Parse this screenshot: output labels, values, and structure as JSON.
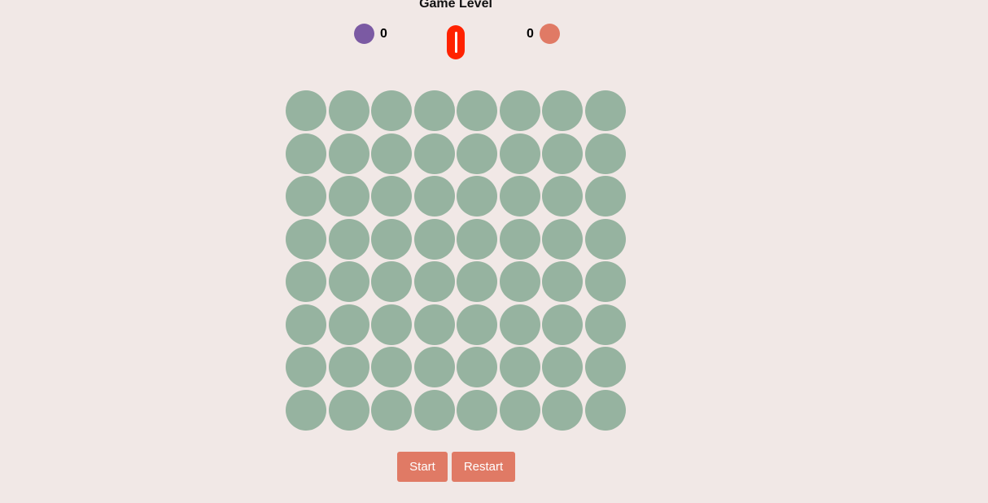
{
  "header": {
    "title": "Game Level"
  },
  "players": [
    {
      "score": "0",
      "color": "#7b5aa3",
      "icon": "purple-token-icon"
    },
    {
      "score": "0",
      "color": "#e07a65",
      "icon": "orange-token-icon"
    }
  ],
  "level_indicator": {
    "color": "#ff2200"
  },
  "board": {
    "rows": 8,
    "cols": 8,
    "empty_color": "#96b3a0"
  },
  "controls": {
    "start_label": "Start",
    "restart_label": "Restart",
    "button_color": "#e07a65"
  }
}
